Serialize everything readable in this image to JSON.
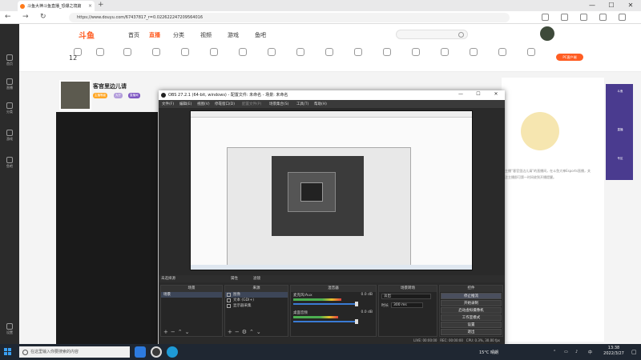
{
  "browser": {
    "tab_title": "斗鱼大神斗鱼直播_恐爆之境篇",
    "url": "https://www.douyu.com/67437817_r=0.022622247209564016",
    "new_tab": "+",
    "close": "×",
    "nav": {
      "back": "←",
      "forward": "→",
      "reload": "↻"
    },
    "window": {
      "minimize": "—",
      "maximize": "☐",
      "close": "✕"
    }
  },
  "douyu": {
    "logo": "斗鱼",
    "nav": [
      "首页",
      "直播",
      "分类",
      "视频",
      "游戏",
      "鱼吧"
    ],
    "left_sidebar": [
      {
        "label": "首页",
        "icon": "home-icon"
      },
      {
        "label": "直播",
        "icon": "live-icon"
      },
      {
        "label": "分类",
        "icon": "category-icon"
      },
      {
        "label": "游戏",
        "icon": "game-icon"
      },
      {
        "label": "鱼吧",
        "icon": "fish-icon"
      },
      {
        "label": "设置",
        "icon": "gear-icon"
      }
    ],
    "badge_count": "12",
    "pc_button": "PC客户端",
    "streamer": {
      "name": "客官里边儿请",
      "tags": [
        "主播等级",
        "大厅",
        "直播间"
      ]
    },
    "right_panel_text": "主播“客官里边儿请”的直播间，在斗鱼大神Esports直播，关注主播即可第一时间收到开播提醒。",
    "banner_labels": [
      "斗鱼",
      "直播",
      "专区"
    ]
  },
  "obs": {
    "title": "OBS 27.2.1 (64-bit, windows) - 配置文件: 未命名 - 场景: 未命名",
    "menu": [
      "文件(F)",
      "编辑(E)",
      "视图(V)",
      "停靠窗口(D)",
      "配置文件(P)",
      "场景集合(S)",
      "工具(T)",
      "帮助(H)"
    ],
    "scene_header": "未选择源",
    "properties": "属性",
    "filters": "滤镜",
    "docks": {
      "scenes": {
        "title": "场景",
        "items": [
          "场景"
        ]
      },
      "sources": {
        "title": "来源",
        "items": [
          "图像",
          "文本 (GDI+)",
          "显示器采集"
        ]
      },
      "mixer": {
        "title": "混音器",
        "channels": [
          {
            "name": "麦克风/Aux",
            "db": "0.0 dB",
            "level": 0.62
          },
          {
            "name": "桌面音频",
            "db": "0.0 dB",
            "level": 0.58
          }
        ]
      },
      "transitions": {
        "title": "场景转场",
        "type": "淡出",
        "duration_label": "时长",
        "duration": "300 ms"
      },
      "controls": {
        "title": "控件",
        "buttons": [
          "停止推流",
          "开始录制",
          "启动虚拟摄像机",
          "工作室模式",
          "设置",
          "退出"
        ]
      }
    },
    "status": {
      "live": "LIVE: 00:00:00",
      "rec": "REC: 00:00:00",
      "cpu": "CPU: 0.3%, 30.00 fps"
    }
  },
  "taskbar": {
    "search_placeholder": "在这里输入你要搜索的内容",
    "weather": "15°C 晴朗",
    "ime": "中",
    "time": "13:38",
    "date": "2022/3/27"
  },
  "colors": {
    "douyu_orange": "#ff5d23",
    "obs_bg": "#2a2a2a",
    "taskbar": "#1f2732",
    "selection": "#3d4658"
  }
}
